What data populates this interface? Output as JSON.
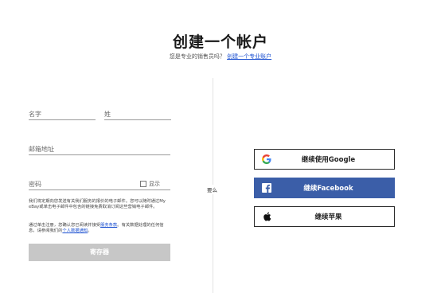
{
  "header": {
    "title": "创建一个帐户",
    "subtitle_prefix": "您是专业的销售员吗？",
    "subtitle_link": "创建一个专业账户"
  },
  "form": {
    "first_name_placeholder": "名字",
    "last_name_placeholder": "姓",
    "email_placeholder": "邮箱地址",
    "password_placeholder": "密码",
    "show_label": "显示",
    "notice_text": "我们将定期向您发送有关我们服务的报价的电子邮件。您可以随时通过My eBay或单击电子邮件中包含的链接免费取消订阅这些营销电子邮件。",
    "terms_prefix": "通过单击注册，您确认您已阅读并接受",
    "terms_link": "服务条款",
    "terms_middle": "。有关数据处理的任何信息，请参阅我们的",
    "privacy_link": "个人数据通知",
    "terms_suffix": "。",
    "register_label": "寄存器"
  },
  "or_label": "要么",
  "social": {
    "google_label": "继续使用Google",
    "facebook_label": "继续Facebook",
    "apple_label": "继续苹果"
  },
  "colors": {
    "facebook_blue": "#3b5ea8",
    "link_blue": "#1a4fd0",
    "register_disabled": "#c7c7c7"
  }
}
